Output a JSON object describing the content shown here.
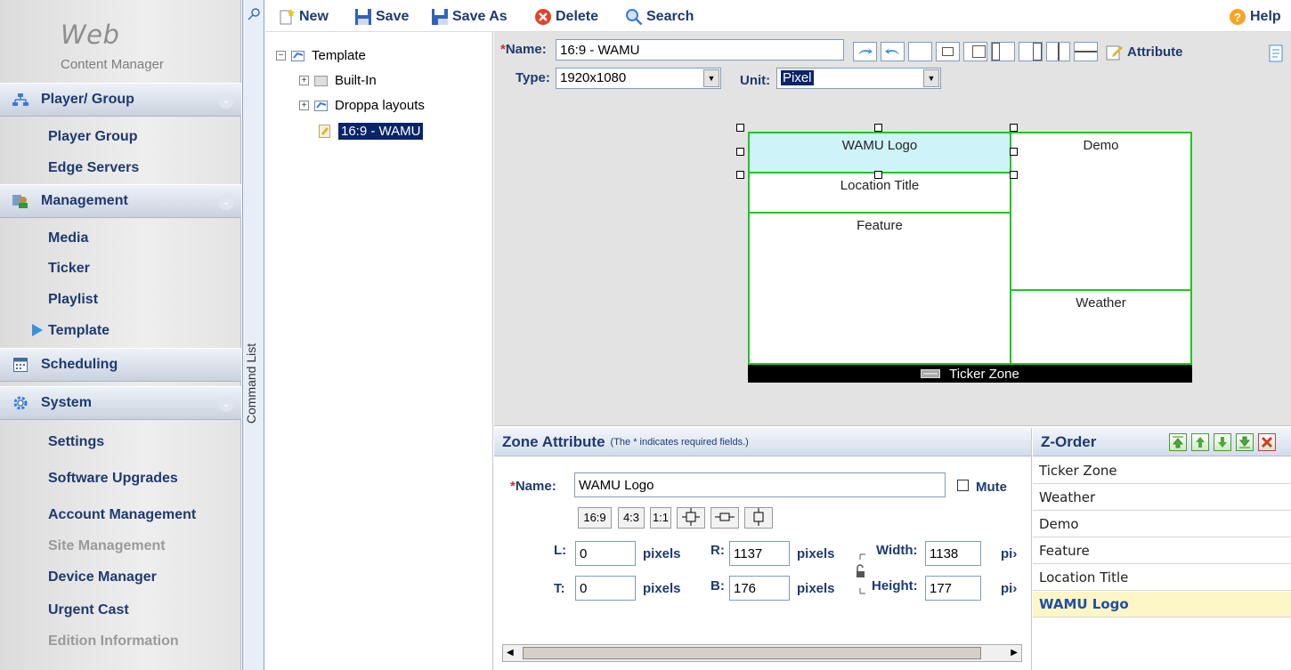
{
  "sidebar": {
    "logo_main": "Web",
    "logo_sub": "Content Manager",
    "sections": [
      {
        "label": "Player/ Group",
        "icon": "network-icon"
      },
      {
        "label": "Management",
        "icon": "management-icon"
      },
      {
        "label": "Scheduling",
        "icon": "calendar-icon"
      },
      {
        "label": "System",
        "icon": "gear-icon"
      }
    ],
    "player_items": [
      "Player Group",
      "Edge Servers"
    ],
    "management_items": [
      "Media",
      "Ticker",
      "Playlist",
      "Template"
    ],
    "system_items": [
      "Settings",
      "Software Upgrades",
      "Account Management",
      "Site Management",
      "Device Manager",
      "Urgent Cast",
      "Edition Information"
    ]
  },
  "command_list": {
    "label": "Command List"
  },
  "toolbar": {
    "new_label": "New",
    "save_label": "Save",
    "save_as_label": "Save As",
    "delete_label": "Delete",
    "search_label": "Search",
    "help_label": "Help"
  },
  "tree": {
    "root": "Template",
    "children": [
      "Built-In",
      "Droppa layouts"
    ],
    "selected": "16:9 - WAMU"
  },
  "editor": {
    "name_label": "Name:",
    "name_value": "16:9 - WAMU",
    "type_label": "Type:",
    "type_value": "1920x1080",
    "unit_label": "Unit:",
    "unit_value": "Pixel",
    "attribute_label": "Attribute"
  },
  "canvas": {
    "zones": [
      "WAMU Logo",
      "Location Title",
      "Feature",
      "Demo",
      "Weather"
    ],
    "ticker": "Ticker Zone"
  },
  "zone_attribute": {
    "title": "Zone Attribute",
    "note": "(The * indicates required fields.)",
    "name_label": "Name:",
    "name_value": "WAMU Logo",
    "mute_label": "Mute",
    "ratios": [
      "16:9",
      "4:3",
      "1:1"
    ],
    "l_label": "L:",
    "l_value": "0",
    "t_label": "T:",
    "t_value": "0",
    "r_label": "R:",
    "r_value": "1137",
    "b_label": "B:",
    "b_value": "176",
    "width_label": "Width:",
    "width_value": "1138",
    "height_label": "Height:",
    "height_value": "177",
    "unit_text": "pixels",
    "unit_trunc": "pi›"
  },
  "zorder": {
    "title": "Z-Order",
    "items": [
      "Ticker Zone",
      "Weather",
      "Demo",
      "Feature",
      "Location Title",
      "WAMU Logo"
    ],
    "active": "WAMU Logo"
  },
  "colors": {
    "accent": "#1e3a70",
    "zone_border": "#22c422",
    "selected_zone": "#cef4fa",
    "selected_tree": "#0a246a"
  }
}
